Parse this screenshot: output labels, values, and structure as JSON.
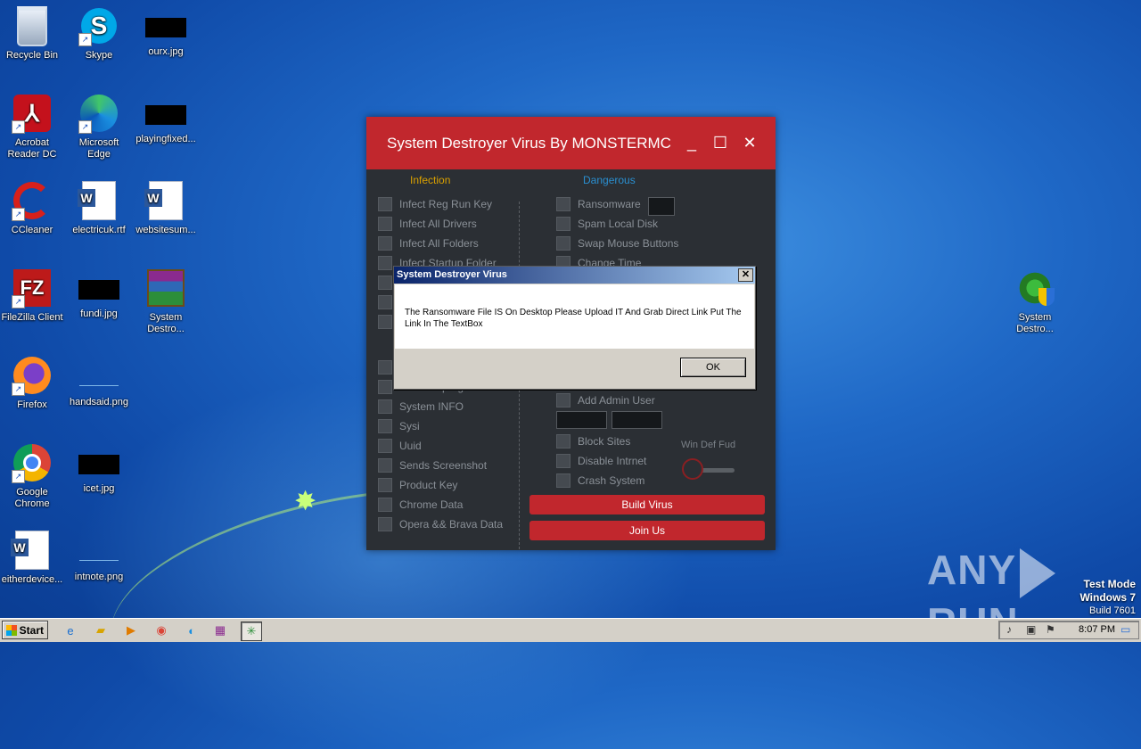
{
  "desktop": {
    "icons": [
      {
        "label": "Recycle Bin",
        "icon": "recycle-bin-icon"
      },
      {
        "label": "Skype",
        "icon": "skype-icon"
      },
      {
        "label": "ourx.jpg",
        "icon": "image-file-icon"
      },
      {
        "label": "Acrobat Reader DC",
        "icon": "acrobat-icon"
      },
      {
        "label": "Microsoft Edge",
        "icon": "edge-icon"
      },
      {
        "label": "playingfixed...",
        "icon": "image-file-icon"
      },
      {
        "label": "CCleaner",
        "icon": "ccleaner-icon"
      },
      {
        "label": "electricuk.rtf",
        "icon": "word-doc-icon"
      },
      {
        "label": "websitesum...",
        "icon": "word-doc-icon"
      },
      {
        "label": "FileZilla Client",
        "icon": "filezilla-icon"
      },
      {
        "label": "fundi.jpg",
        "icon": "image-file-icon"
      },
      {
        "label": "System Destro...",
        "icon": "winrar-icon"
      },
      {
        "label": "Firefox",
        "icon": "firefox-icon"
      },
      {
        "label": "handsaid.png",
        "icon": "image-file-icon"
      },
      {
        "label": "Google Chrome",
        "icon": "chrome-icon"
      },
      {
        "label": "icet.jpg",
        "icon": "image-file-icon"
      },
      {
        "label": "eitherdevice...",
        "icon": "word-doc-icon"
      },
      {
        "label": "intnote.png",
        "icon": "image-file-icon"
      },
      {
        "label": "System Destro...",
        "icon": "system-destroyer-icon"
      }
    ]
  },
  "app": {
    "title": "System Destroyer Virus By MONSTERMC",
    "controls": {
      "minimize": "_",
      "maximize": "☐",
      "close": "✕"
    },
    "sections": {
      "infection": "Infection",
      "dangerous": "Dangerous"
    },
    "left_options": [
      "Infect Reg Run Key",
      "Infect All Drivers",
      "Infect All Folders",
      "Infect Startup Folder",
      "",
      "",
      "",
      "Installed programms",
      "System INFO",
      "Sysi",
      "Uuid",
      "Sends Screenshot",
      "Product Key",
      "Chrome Data",
      "Opera && Brava Data"
    ],
    "right_options_top": [
      "Ransomware",
      "Spam Local Disk",
      "Swap Mouse Buttons",
      "Change Time"
    ],
    "right_options_bottom": [
      "Add Admin User",
      "Block Sites",
      "Disable Intrnet",
      "Crash System"
    ],
    "win_def_label": "Win Def Fud",
    "win_def_enabled": false,
    "build_button": "Build Virus",
    "join_button": "Join Us"
  },
  "dialog": {
    "title": "System Destroyer Virus",
    "message": "The Ransomware File IS On Desktop Please Upload IT And Grab Direct Link Put The Link In The TextBox",
    "ok": "OK",
    "close": "✕"
  },
  "watermark": {
    "text_left": "ANY",
    "text_right": "RUN"
  },
  "test_mode": {
    "line1": "Test Mode",
    "line2": "Windows 7",
    "line3": "Build 7601"
  },
  "taskbar": {
    "start": "Start",
    "clock": "8:07 PM",
    "pinned": [
      "ie-icon",
      "explorer-icon",
      "media-player-icon",
      "chrome-icon",
      "edge-icon",
      "winrar-icon",
      "system-destroyer-icon"
    ]
  }
}
